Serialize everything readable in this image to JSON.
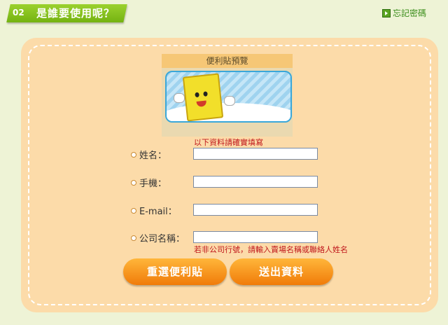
{
  "step": {
    "number": "02",
    "title": "是誰要使用呢？"
  },
  "forgot_password": {
    "label": "忘記密碼",
    "icon": "arrow-right-icon"
  },
  "preview": {
    "title": "便利貼預覽"
  },
  "form": {
    "hint": "以下資料請確實填寫",
    "fields": [
      {
        "label": "姓名：",
        "value": ""
      },
      {
        "label": "手機：",
        "value": ""
      },
      {
        "label": "E-mail：",
        "value": ""
      },
      {
        "label": "公司名稱：",
        "value": ""
      }
    ],
    "company_note": "若非公司行號，請輸入賣場名稱或聯絡人姓名"
  },
  "buttons": {
    "reset": "重選便利貼",
    "submit": "送出資料"
  },
  "colors": {
    "accent_green": "#8cc63f",
    "panel": "#fcdba9",
    "button_orange": "#f38a10",
    "note_red": "#c0171c"
  }
}
